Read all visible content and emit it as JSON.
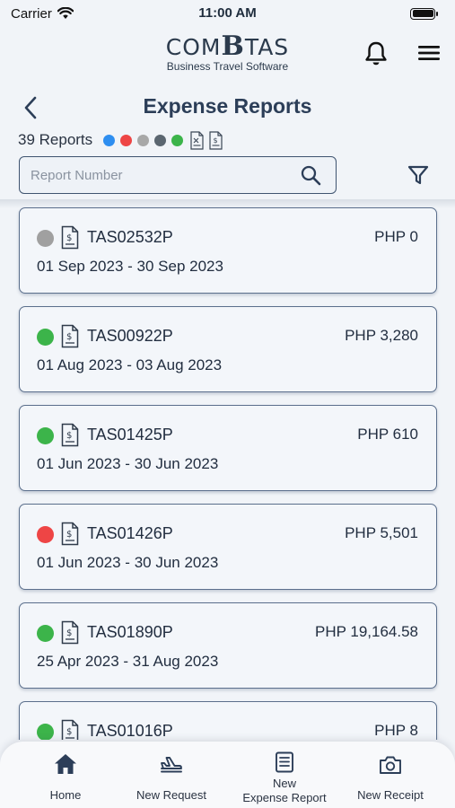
{
  "status_bar": {
    "carrier": "Carrier",
    "time": "11:00 AM"
  },
  "brand": {
    "logo_text_1": "COM",
    "logo_letter": "B",
    "logo_text_2": "TAS",
    "tagline": "Business Travel Software"
  },
  "header": {
    "title": "Expense Reports"
  },
  "summary": {
    "reports_count": "39 Reports",
    "status_colors": [
      "#2e8ef0",
      "#ee4545",
      "#a8a8a8",
      "#5b6670",
      "#3cb44a"
    ]
  },
  "search": {
    "placeholder": "Report Number"
  },
  "reports": [
    {
      "status_color": "#a0a0a0",
      "id": "TAS02532P",
      "amount": "PHP 0",
      "dates": "01 Sep 2023 - 30 Sep 2023"
    },
    {
      "status_color": "#3cb44a",
      "id": "TAS00922P",
      "amount": "PHP 3,280",
      "dates": "01 Aug 2023 - 03 Aug 2023"
    },
    {
      "status_color": "#3cb44a",
      "id": "TAS01425P",
      "amount": "PHP 610",
      "dates": "01 Jun 2023 - 30 Jun 2023"
    },
    {
      "status_color": "#ee4545",
      "id": "TAS01426P",
      "amount": "PHP 5,501",
      "dates": "01 Jun 2023 - 30 Jun 2023"
    },
    {
      "status_color": "#3cb44a",
      "id": "TAS01890P",
      "amount": "PHP 19,164.58",
      "dates": "25 Apr 2023 - 31 Aug 2023"
    },
    {
      "status_color": "#3cb44a",
      "id": "TAS01016P",
      "amount": "PHP 8",
      "dates": ""
    }
  ],
  "bottom_nav": [
    {
      "icon": "home-icon",
      "label": "Home"
    },
    {
      "icon": "airplane-icon",
      "label": "New Request"
    },
    {
      "icon": "expense-report-icon",
      "label_line1": "New",
      "label_line2": "Expense Report"
    },
    {
      "icon": "camera-icon",
      "label": "New Receipt"
    }
  ]
}
